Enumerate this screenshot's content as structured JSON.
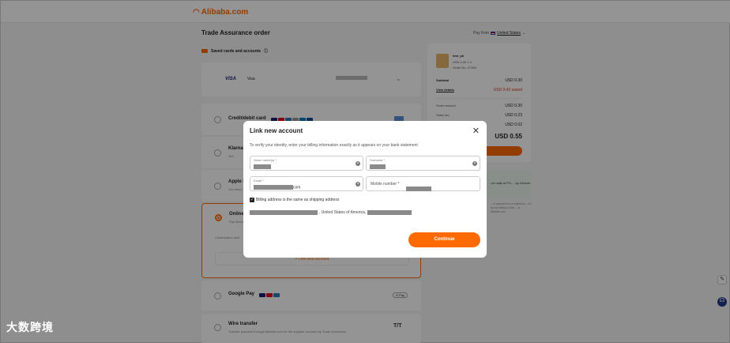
{
  "header": {
    "logo": "Alibaba.com",
    "page_title": "Trade Assurance order",
    "pay_from_label": "Pay from",
    "pay_from_value": "United States"
  },
  "saved": {
    "title": "Saved cards and accounts",
    "card_brand": "VISA",
    "card_label": "Visa"
  },
  "payment_options": [
    {
      "title": "Credit/debit card",
      "sub": ""
    },
    {
      "title": "Klarna",
      "sub": "Sell"
    },
    {
      "title": "Apple P",
      "sub": "You need"
    },
    {
      "title": "Online",
      "sub": "Pay directly"
    },
    {
      "title": "Google Pay",
      "sub": ""
    },
    {
      "title": "Wire transfer",
      "sub": "Transfer payment through Alibaba.com for the supplier, secured by Trade Assurance."
    }
  ],
  "online_note": "Confirmation sent",
  "link_new_account_label": "+ Link new account",
  "gpay_badge": "G Pay",
  "tt_label": "T/T",
  "summary": {
    "item_title": "test_ph",
    "item_price": "USD 0.40 × 1",
    "order_no": "Order No: 27183",
    "subtotal_label": "Subtotal",
    "subtotal_value": "USD 0.30",
    "view_details": "View details",
    "saved_value": "USD 3.42 saved",
    "order_amount_label": "Order amount",
    "order_amount_value": "USD 0.30",
    "sales_tax_label": "Sales tax",
    "sales_tax_value": "USD 0.23",
    "extra_value": "USD 0.02",
    "total": "USD 0.55"
  },
  "promo": {
    "text": "...ke calls to PO. ...ay Verizon"
  },
  "footnote": "...ur payment is on business ...ed by the details of the ...of Alibaba.com",
  "modal": {
    "title": "Link new account",
    "instruction": "To verify your identity, enter your billing information exactly as it appears on your bank statement",
    "given_names_label": "Given name(s) *",
    "surname_label": "Surname *",
    "email_label": "Email *",
    "email_suffix": "com",
    "mobile_label": "Mobile number *",
    "checkbox_label": "Billing address is the same as shipping address",
    "address_text": ", United States of America,",
    "continue_label": "Continue"
  },
  "watermark": "大数跨境",
  "colors": {
    "accent": "#ff6a00",
    "visa": "#1a1f71",
    "saved_red": "#d9361b"
  }
}
